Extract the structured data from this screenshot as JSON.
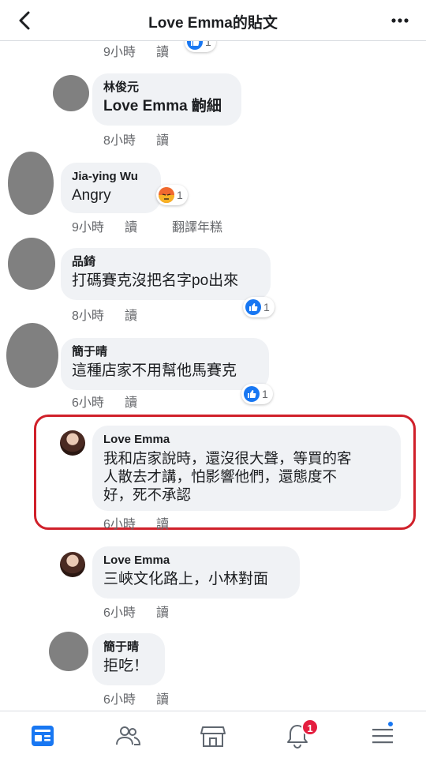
{
  "header": {
    "title": "Love Emma的貼文"
  },
  "colors": {
    "accent": "#1877f2",
    "highlight_border": "#d0202a",
    "badge": "#e41e3f",
    "bubble": "#f0f2f5"
  },
  "top_meta": {
    "time": "9小時",
    "read": "讀",
    "reaction_count": "1"
  },
  "comments": [
    {
      "name": "林俊元",
      "text": "Love Emma 齣細",
      "time": "8小時",
      "read": "讀"
    },
    {
      "name": "Jia-ying Wu",
      "text": "Angry",
      "time": "9小時",
      "read": "讀",
      "translate": "翻譯年糕",
      "reaction_count": "1",
      "reaction": "angry"
    },
    {
      "name": "品錡",
      "text": "打碼賽克沒把名字po出來",
      "time": "8小時",
      "read": "讀",
      "reaction_count": "1",
      "reaction": "like"
    },
    {
      "name": "簡于晴",
      "text": "這種店家不用幫他馬賽克",
      "time": "6小時",
      "read": "讀",
      "reaction_count": "1",
      "reaction": "like"
    },
    {
      "name": "Love Emma",
      "lines": [
        "我和店家說時，還沒很大聲，等買的客",
        "人散去才講，怕影響他們，還態度不",
        "好，死不承認"
      ],
      "time": "6小時",
      "read": "讀"
    },
    {
      "name": "Love Emma",
      "text": "三峽文化路上，小林對面",
      "time": "6小時",
      "read": "讀"
    },
    {
      "name": "簡于晴",
      "text": "拒吃！",
      "time": "6小時",
      "read": "讀"
    }
  ],
  "tabbar": {
    "items": [
      "news-feed",
      "friends",
      "marketplace",
      "notifications",
      "menu"
    ],
    "notification_badge": "1"
  }
}
